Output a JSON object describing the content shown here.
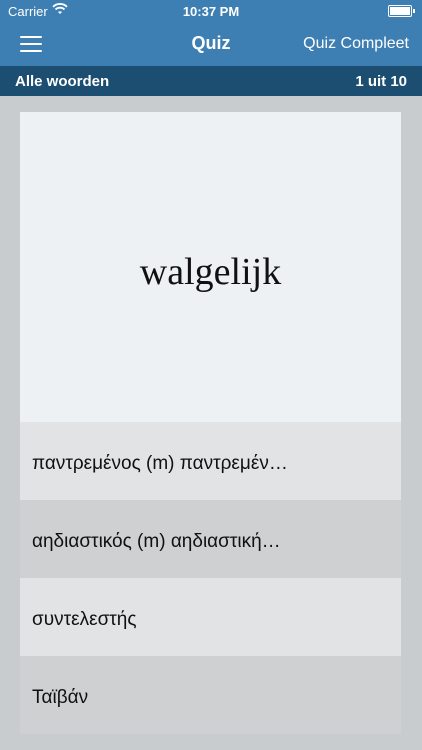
{
  "status_bar": {
    "carrier": "Carrier",
    "time": "10:37 PM",
    "icons": [
      "wifi-icon",
      "battery-icon"
    ]
  },
  "nav": {
    "title": "Quiz",
    "action": "Quiz Compleet",
    "menu_icon": "hamburger-menu-icon"
  },
  "subheader": {
    "category": "Alle woorden",
    "progress": "1 uit 10"
  },
  "question": {
    "word": "walgelijk"
  },
  "options": [
    {
      "label": "παντρεμένος (m)  παντρεμέν…"
    },
    {
      "label": "αηδιαστικός (m)  αηδιαστική…"
    },
    {
      "label": "συντελεστής"
    },
    {
      "label": "Ταϊβάν"
    }
  ],
  "colors": {
    "nav_blue": "#3e7fb3",
    "subheader_blue": "#1c4e72",
    "card_bg": "#eef1f3",
    "background": "#c9cccf"
  }
}
